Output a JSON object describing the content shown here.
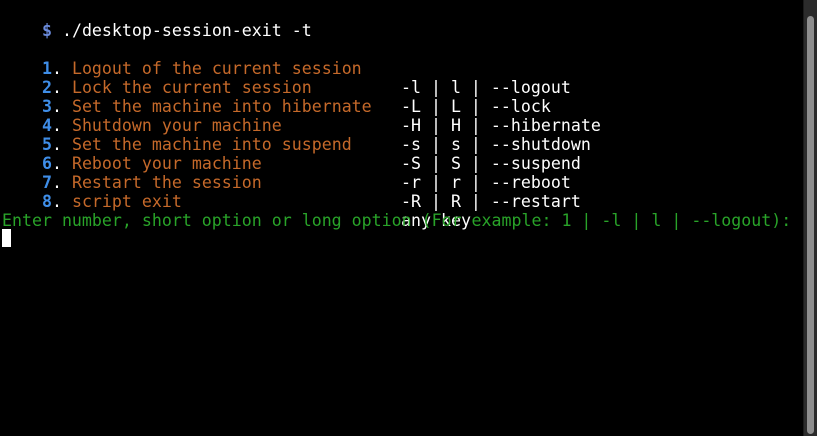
{
  "colors": {
    "prompt": "#6b8bdc",
    "number": "#3f8ee8",
    "description": "#c5692a",
    "option": "#ffffff",
    "input_prompt": "#29a329"
  },
  "prompt": {
    "symbol": "$",
    "command": " ./desktop-session-exit -t"
  },
  "menu": [
    {
      "number": "1",
      "description": "Logout of the current session",
      "options": "-l | l | --logout"
    },
    {
      "number": "2",
      "description": "Lock the current session",
      "options": "-L | L | --lock"
    },
    {
      "number": "3",
      "description": "Set the machine into hibernate",
      "options": "-H | H | --hibernate"
    },
    {
      "number": "4",
      "description": "Shutdown your machine",
      "options": "-s | s | --shutdown"
    },
    {
      "number": "5",
      "description": "Set the machine into suspend",
      "options": "-S | S | --suspend"
    },
    {
      "number": "6",
      "description": "Reboot your machine",
      "options": "-r | r | --reboot"
    },
    {
      "number": "7",
      "description": "Restart the session",
      "options": "-R | R | --restart"
    },
    {
      "number": "8",
      "description": "script exit",
      "options": "any key"
    }
  ],
  "menu_separator": ". ",
  "input_prompt": "Enter number, short option or long option (For example: 1 | -l | l | --logout):"
}
